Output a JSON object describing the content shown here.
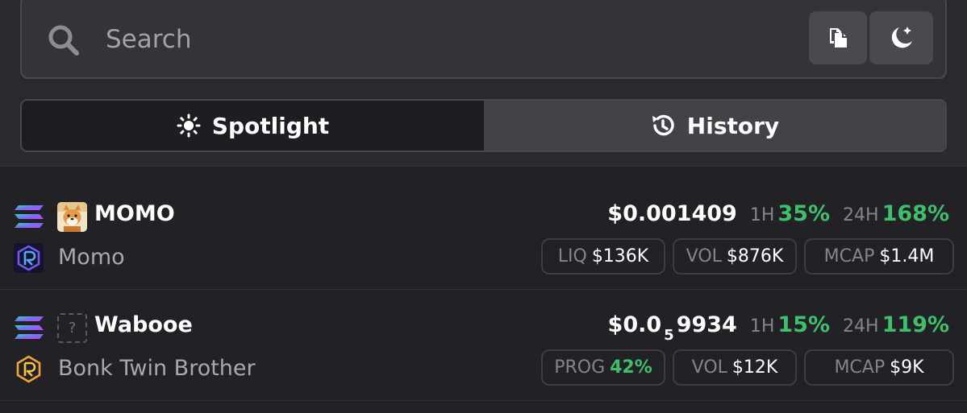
{
  "search": {
    "placeholder": "Search"
  },
  "tabs": [
    {
      "label": "Spotlight",
      "icon": "sun-icon",
      "active": true
    },
    {
      "label": "History",
      "icon": "history-icon",
      "active": false
    }
  ],
  "header_buttons": {
    "copy": "copy-icon",
    "theme": "moon-star-icon"
  },
  "tokens": [
    {
      "chain_icon": "solana-icon",
      "dex_icon": "raydium-icon",
      "symbol": "MOMO",
      "name": "Momo",
      "price_prefix": "$0.001409",
      "price_sub": "",
      "price_tail": "",
      "change_1h_label": "1H",
      "change_1h": "35%",
      "change_24h_label": "24H",
      "change_24h": "168%",
      "stats": [
        {
          "label": "LIQ",
          "value": "$136K",
          "green": false
        },
        {
          "label": "VOL",
          "value": "$876K",
          "green": false
        },
        {
          "label": "MCAP",
          "value": "$1.4M",
          "green": false
        }
      ]
    },
    {
      "chain_icon": "solana-icon",
      "dex_icon": "raydium-icon",
      "symbol": "Wabooe",
      "name": "Bonk Twin Brother",
      "placeholder_glyph": "?",
      "price_prefix": "$0.0",
      "price_sub": "5",
      "price_tail": "9934",
      "change_1h_label": "1H",
      "change_1h": "15%",
      "change_24h_label": "24H",
      "change_24h": "119%",
      "stats": [
        {
          "label": "PROG",
          "value": "42%",
          "green": true
        },
        {
          "label": "VOL",
          "value": "$12K",
          "green": false
        },
        {
          "label": "MCAP",
          "value": "$9K",
          "green": false
        }
      ]
    }
  ],
  "colors": {
    "positive": "#3fbf6b",
    "background": "#222126",
    "text": "#ecebef"
  }
}
